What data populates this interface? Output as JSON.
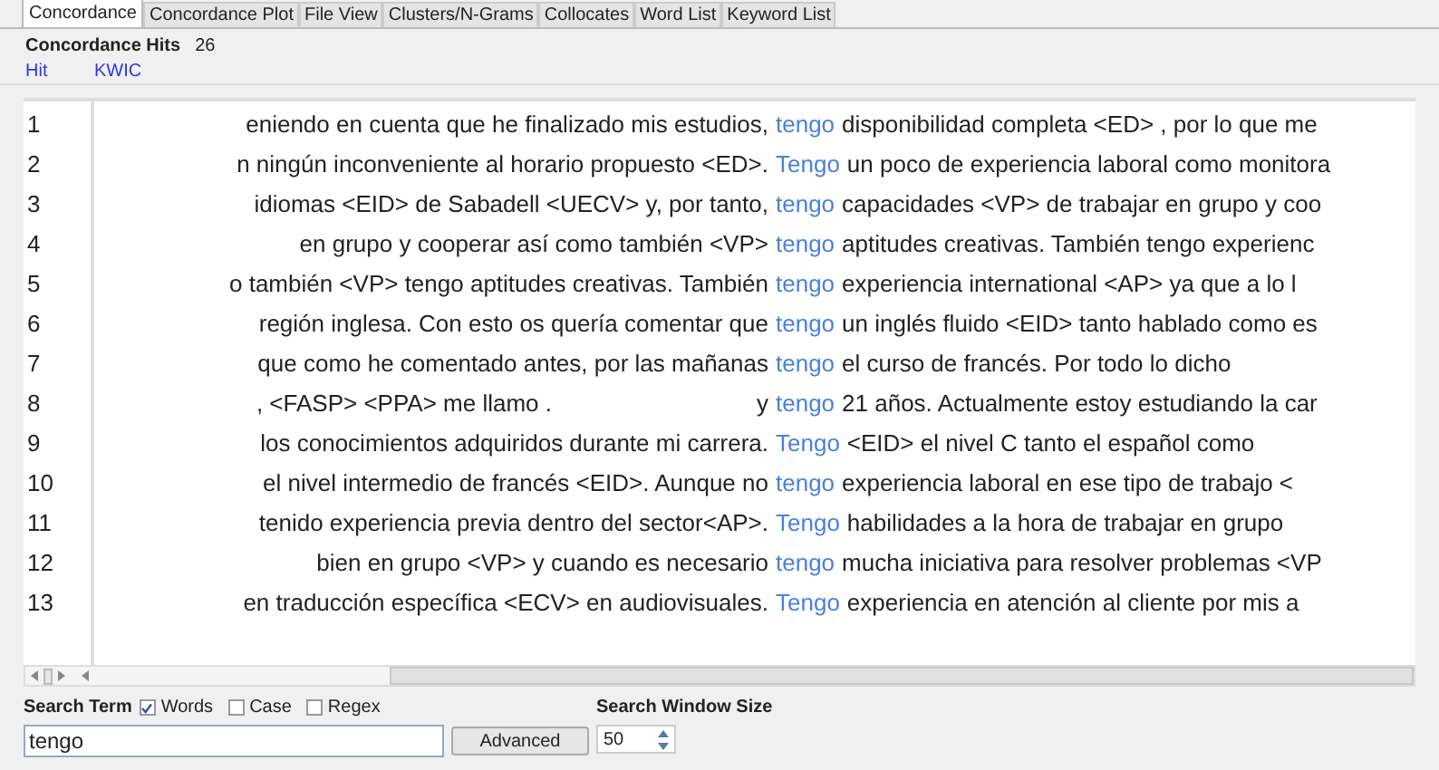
{
  "tabs": [
    {
      "label": "Concordance",
      "selected": true
    },
    {
      "label": "Concordance Plot",
      "selected": false
    },
    {
      "label": "File View",
      "selected": false
    },
    {
      "label": "Clusters/N-Grams",
      "selected": false
    },
    {
      "label": "Collocates",
      "selected": false
    },
    {
      "label": "Word List",
      "selected": false
    },
    {
      "label": "Keyword List",
      "selected": false
    }
  ],
  "hits": {
    "label": "Concordance Hits",
    "count": "26"
  },
  "columns": [
    "Hit",
    "KWIC"
  ],
  "rows": [
    {
      "hit": "1",
      "left": "eniendo en cuenta que he finalizado mis estudios,",
      "word": "tengo",
      "right": "disponibilidad completa <ED> , por lo que me"
    },
    {
      "hit": "2",
      "left": "n ningún inconveniente al horario propuesto <ED>.",
      "word": "Tengo",
      "right": "un poco de experiencia laboral como monitora"
    },
    {
      "hit": "3",
      "left": "idiomas <EID> de Sabadell <UECV> y, por tanto,",
      "word": "tengo",
      "right": "capacidades  <VP> de trabajar en grupo y coo"
    },
    {
      "hit": "4",
      "left": "en grupo y cooperar así como también <VP>",
      "word": "tengo",
      "right": "aptitudes creativas. También tengo experienc"
    },
    {
      "hit": "5",
      "left": "o también <VP> tengo aptitudes creativas. También",
      "word": "tengo",
      "right": "experiencia international <AP> ya que a lo l"
    },
    {
      "hit": "6",
      "left": "región inglesa. Con esto os quería comentar que",
      "word": "tengo",
      "right": "un inglés fluido <EID> tanto hablado como es"
    },
    {
      "hit": "7",
      "left": "que como he comentado antes, por las mañanas",
      "word": "tengo",
      "right": "el curso de francés.  Por todo lo dicho"
    },
    {
      "hit": "8",
      "left": ", <FASP>  <PPA> me llamo .",
      "left_end": "y",
      "word": "tengo",
      "right": "21 años. Actualmente estoy estudiando la car"
    },
    {
      "hit": "9",
      "left": "los conocimientos adquiridos durante mi carrera.",
      "word": "Tengo",
      "right": "<EID> el nivel C tanto el español como"
    },
    {
      "hit": "10",
      "left": "el nivel intermedio de francés <EID>. Aunque no",
      "word": "tengo",
      "right": "experiencia laboral en ese tipo de trabajo <"
    },
    {
      "hit": "11",
      "left": "tenido experiencia previa dentro del sector<AP>.",
      "word": "Tengo",
      "right": "habilidades a la hora de trabajar en grupo"
    },
    {
      "hit": "12",
      "left": "bien en grupo <VP> y cuando es necesario",
      "word": "tengo",
      "right": "mucha iniciativa para resolver problemas <VP"
    },
    {
      "hit": "13",
      "left": "en traducción específica <ECV> en audiovisuales.",
      "word": "Tengo",
      "right": "experiencia en atención al cliente por mis a"
    }
  ],
  "search": {
    "label": "Search Term",
    "options": [
      {
        "label": "Words",
        "checked": true
      },
      {
        "label": "Case",
        "checked": false
      },
      {
        "label": "Regex",
        "checked": false
      }
    ],
    "value": "tengo",
    "button": "Advanced"
  },
  "window_size": {
    "label": "Search Window Size",
    "value": "50"
  }
}
